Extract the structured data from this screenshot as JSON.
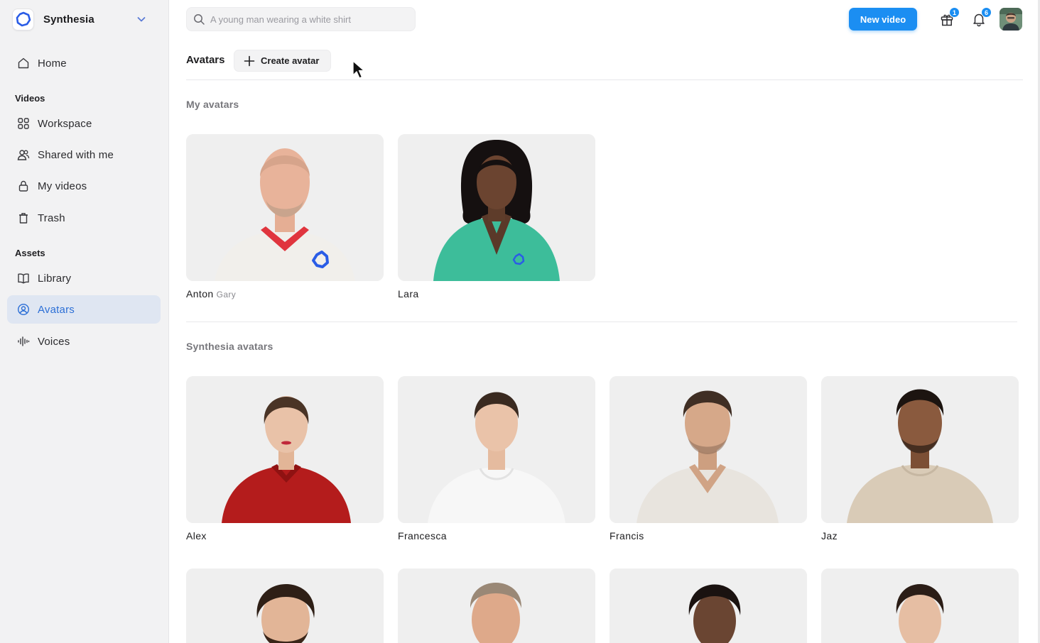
{
  "workspace": {
    "name": "Synthesia",
    "logo_icon": "synthesia-logo-icon",
    "dropdown_icon": "chevron-down-icon"
  },
  "sidebar": {
    "home": {
      "label": "Home",
      "icon": "home-icon"
    },
    "videos_section": "Videos",
    "videos_items": [
      {
        "label": "Workspace",
        "icon": "grid-icon"
      },
      {
        "label": "Shared with me",
        "icon": "users-icon"
      },
      {
        "label": "My videos",
        "icon": "lock-icon"
      },
      {
        "label": "Trash",
        "icon": "trash-icon"
      }
    ],
    "assets_section": "Assets",
    "assets_items": [
      {
        "label": "Library",
        "icon": "book-icon"
      },
      {
        "label": "Avatars",
        "icon": "user-circle-icon",
        "active": true
      },
      {
        "label": "Voices",
        "icon": "waveform-icon"
      }
    ]
  },
  "header": {
    "search_placeholder": "A young man wearing a white shirt",
    "new_video_label": "New video",
    "gift_badge": "1",
    "notifications_badge": "6",
    "accent_color": "#1b8ef2"
  },
  "tabs": {
    "title": "Avatars",
    "create_label": "Create avatar"
  },
  "my_avatars": {
    "title": "My avatars",
    "items": [
      {
        "name": "Anton",
        "sub": "Gary",
        "bg": "#efefef",
        "skin": "#e8b39a",
        "hair": "#c9a48d",
        "shirt": "#f2f0ec",
        "collar": "#e0353e",
        "bald": true,
        "beard": true,
        "logo": true
      },
      {
        "name": "Lara",
        "sub": "",
        "bg": "#efefef",
        "skin": "#6b4430",
        "hair": "#151010",
        "shirt": "#3dbd9a",
        "collar": "",
        "longhair": true,
        "logo": true
      }
    ]
  },
  "synthesia_avatars": {
    "title": "Synthesia avatars",
    "items": [
      {
        "name": "Alex",
        "bg": "#efefef",
        "skin": "#e9c2a8",
        "hair": "#4a3426",
        "shirt": "#b41c1c",
        "collar": ""
      },
      {
        "name": "Francesca",
        "bg": "#efefef",
        "skin": "#eac3a9",
        "hair": "#3a2a20",
        "shirt": "#f7f7f7",
        "collar": ""
      },
      {
        "name": "Francis",
        "bg": "#efefef",
        "skin": "#d6a889",
        "hair": "#3f2e24",
        "shirt": "#e8e4de",
        "collar": "",
        "beard": true
      },
      {
        "name": "Jaz",
        "bg": "#efefef",
        "skin": "#8a5a3e",
        "hair": "#1c1410",
        "shirt": "#d9cbb7",
        "collar": "",
        "beard": true
      }
    ],
    "row2": [
      {
        "bg": "#efefef",
        "skin": "#e2b597",
        "hair": "#2e1f16",
        "beard": true
      },
      {
        "bg": "#efefef",
        "skin": "#dea98a",
        "hair": "#9a8876"
      },
      {
        "bg": "#efefef",
        "skin": "#6a4532",
        "hair": "#1a1210"
      },
      {
        "bg": "#efefef",
        "skin": "#e6bea3",
        "hair": "#2b1d16"
      }
    ]
  }
}
